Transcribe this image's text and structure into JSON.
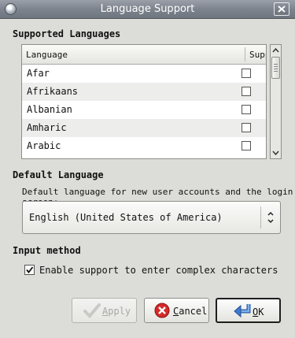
{
  "window": {
    "title": "Language Support"
  },
  "supported": {
    "section_title": "Supported Languages",
    "columns": [
      "Language",
      "Support"
    ],
    "rows": [
      {
        "language": "Afar",
        "supported": false
      },
      {
        "language": "Afrikaans",
        "supported": false
      },
      {
        "language": "Albanian",
        "supported": false
      },
      {
        "language": "Amharic",
        "supported": false
      },
      {
        "language": "Arabic",
        "supported": false
      }
    ]
  },
  "default_language": {
    "section_title": "Default Language",
    "description": "Default language for new user accounts and the login screen:",
    "selected": "English (United States of America)"
  },
  "input_method": {
    "section_title": "Input method",
    "checkbox_label": "Enable support to enter complex characters",
    "checked": true
  },
  "buttons": {
    "apply": {
      "prefix": "",
      "mnemonic": "A",
      "rest": "pply",
      "enabled": false
    },
    "cancel": {
      "prefix": "",
      "mnemonic": "C",
      "rest": "ancel"
    },
    "ok": {
      "prefix": "",
      "mnemonic": "O",
      "rest": "K"
    }
  },
  "icons": {
    "window": "app-icon",
    "close": "close-icon",
    "apply": "checkmark-icon",
    "cancel": "cancel-icon",
    "ok": "enter-arrow-icon"
  },
  "colors": {
    "titlebar": "#7e848e",
    "cancel_icon": "#d42a2a",
    "ok_icon": "#3b7bd0"
  }
}
